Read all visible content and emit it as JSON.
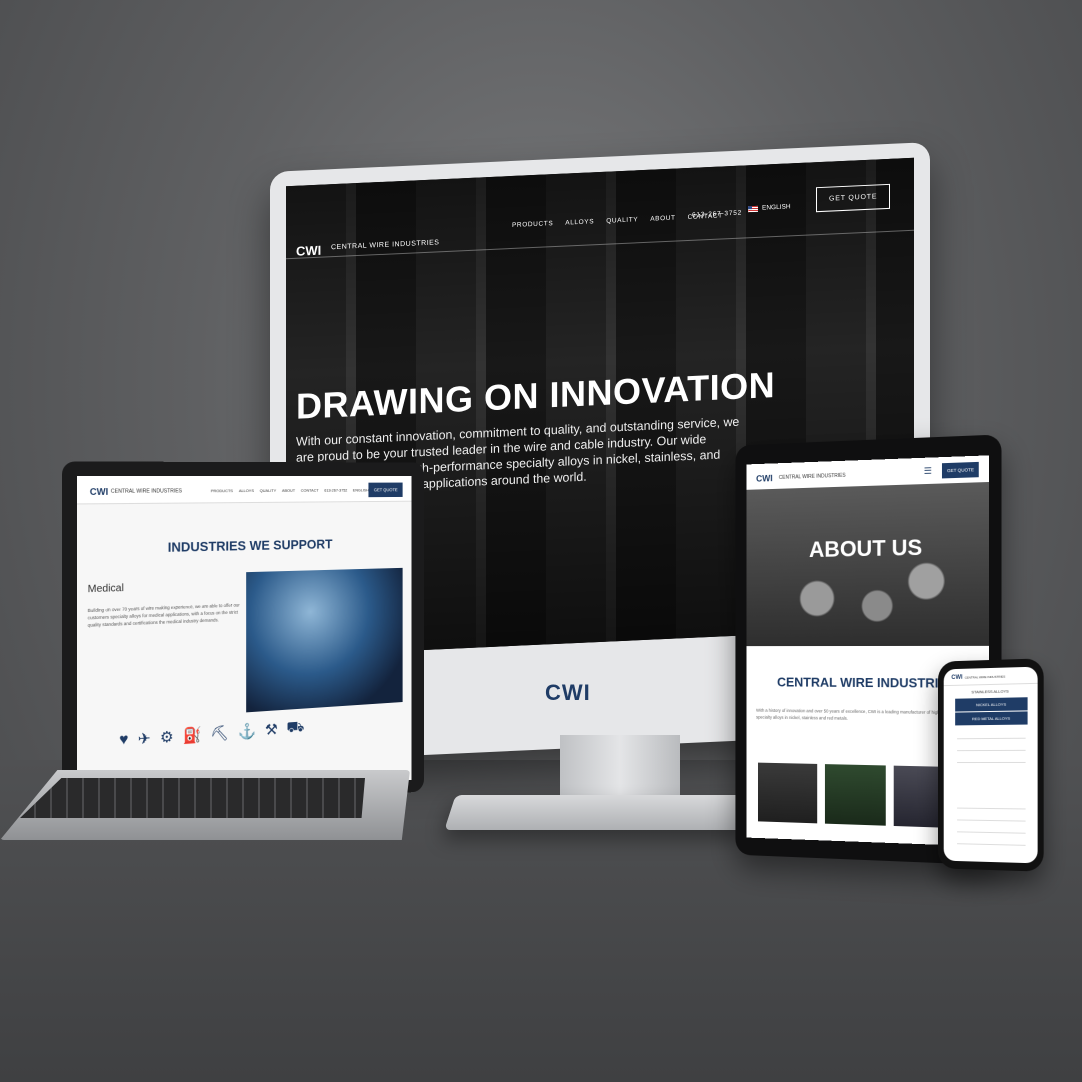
{
  "monitor": {
    "logo": "CWI",
    "brand": "CENTRAL WIRE INDUSTRIES",
    "nav": [
      "PRODUCTS",
      "ALLOYS",
      "QUALITY",
      "ABOUT",
      "CONTACT"
    ],
    "phone": "613-267-3752",
    "language": "ENGLISH",
    "cta": "GET QUOTE",
    "hero_title": "DRAWING ON INNOVATION",
    "hero_text": "With our constant innovation, commitment to quality, and outstanding service, we are proud to be your trusted leader in the wire and cable industry. Our wide ranging products of high-performance specialty alloys in nickel, stainless, and red metals are used in applications around the world.",
    "chin_logo": "CWI"
  },
  "laptop": {
    "logo": "CWI",
    "brand": "CENTRAL WIRE INDUSTRIES",
    "nav": [
      "PRODUCTS",
      "ALLOYS",
      "QUALITY",
      "ABOUT",
      "CONTACT",
      "613-267-3752",
      "ENGLISH"
    ],
    "cta": "GET QUOTE",
    "heading": "INDUSTRIES WE SUPPORT",
    "subheading": "Medical",
    "body": "Building on over 70 years of wire making experience, we are able to offer our customers specialty alloys for medical applications, with a focus on the strict quality standards and certifications the medical industry demands.",
    "icons": [
      "medical-icon",
      "aerospace-icon",
      "industrial-icon",
      "oil-gas-icon",
      "mining-icon",
      "marine-icon",
      "construction-icon",
      "automotive-icon"
    ]
  },
  "tablet": {
    "logo": "CWI",
    "brand": "CENTRAL WIRE INDUSTRIES",
    "cta": "GET QUOTE",
    "hero_title": "ABOUT US",
    "heading": "CENTRAL WIRE INDUSTRIES",
    "body": "With a history of innovation and over 50 years of excellence, CWI is a leading manufacturer of high-performance specialty alloys in nickel, stainless and red metals."
  },
  "phone": {
    "logo": "CWI",
    "brand": "CENTRAL WIRE INDUSTRIES",
    "stainless": "STAINLESS ALLOYS",
    "nickel": "NICKEL ALLOYS",
    "red_metal": "RED METAL ALLOYS"
  },
  "colors": {
    "brand": "#1f3c66"
  }
}
